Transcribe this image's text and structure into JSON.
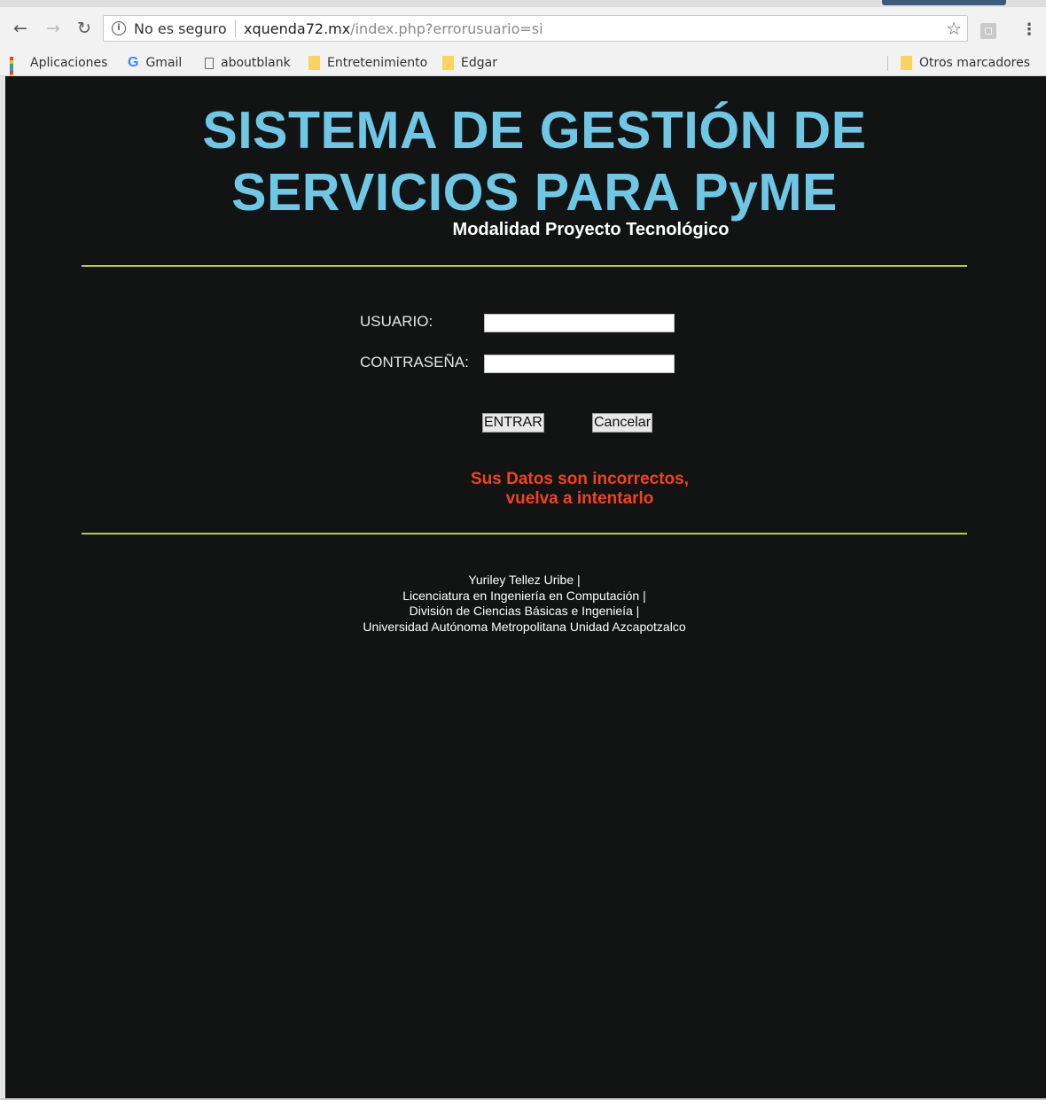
{
  "browser": {
    "security_label": "No es seguro",
    "url_host": "xquenda72.mx",
    "url_path": "/index.php?errorusuario=si",
    "bookmarks": [
      {
        "label": "Aplicaciones",
        "icon": "apps-icon"
      },
      {
        "label": "Gmail",
        "icon": "google-icon"
      },
      {
        "label": "aboutblank",
        "icon": "page-icon"
      },
      {
        "label": "Entretenimiento",
        "icon": "folder-icon"
      },
      {
        "label": "Edgar",
        "icon": "folder-icon"
      }
    ],
    "other_bookmarks": "Otros marcadores",
    "folder_color": "#f8d35e"
  },
  "page": {
    "title_line1": "SISTEMA DE GESTIÓN DE",
    "title_line2": "SERVICIOS PARA PyME",
    "subtitle": "Modalidad Proyecto Tecnológico",
    "title_color": "#6fc7e6",
    "rule_color": "#b9cc3e",
    "background": "#121313"
  },
  "form": {
    "user_label": "USUARIO:",
    "user_value": "",
    "password_label": "CONTRASEÑA:",
    "password_value": "",
    "submit_label": "ENTRAR",
    "cancel_label": "Cancelar"
  },
  "error": {
    "line1": "Sus Datos son incorrectos,",
    "line2": "vuelva a intentarlo",
    "color": "#f3421a"
  },
  "footer": {
    "lines": [
      "Yuriley Tellez Uribe |",
      "Licenciatura en Ingeniería en Computación |",
      "División de Ciencias Básicas e Ingenieía |",
      "Universidad Autónoma Metropolitana Unidad Azcapotzalco"
    ]
  }
}
